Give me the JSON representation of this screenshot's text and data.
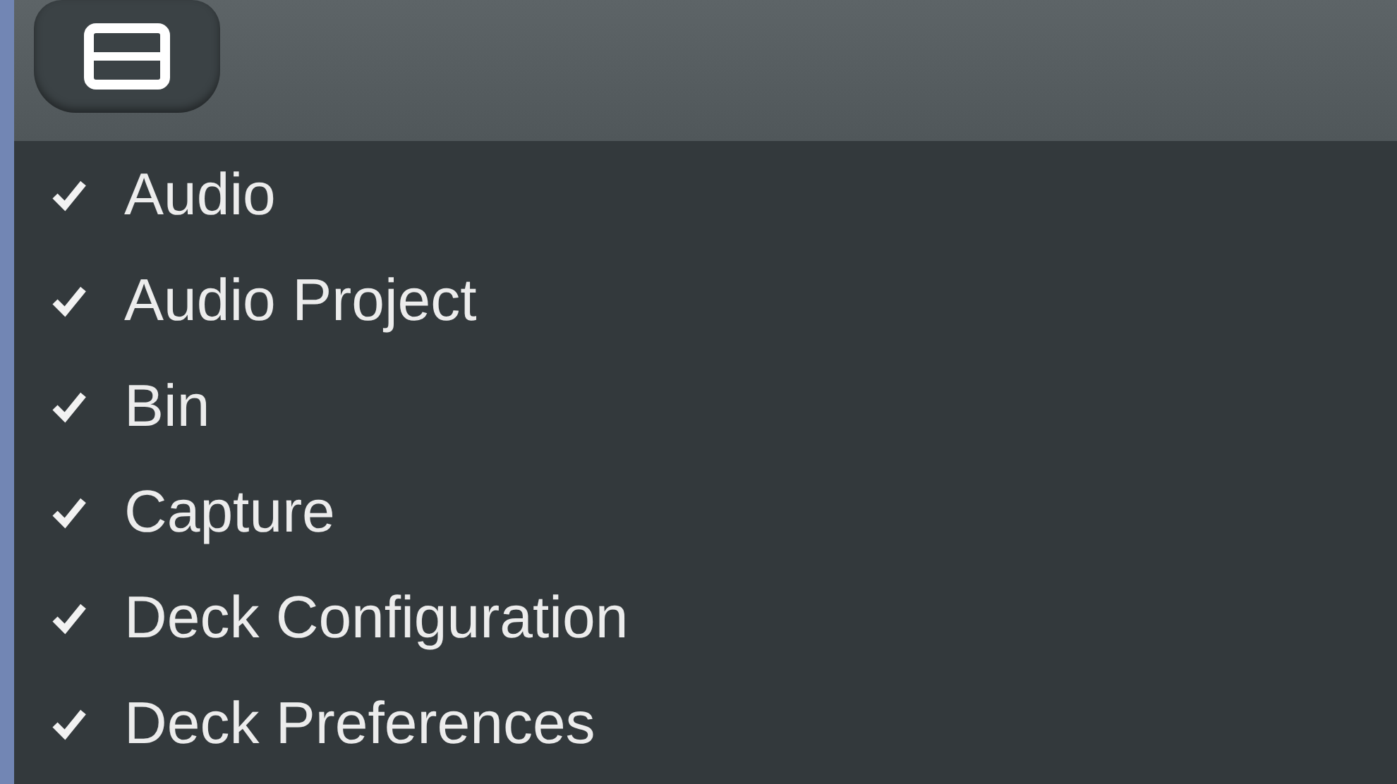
{
  "menu": {
    "items": [
      {
        "label": "Audio",
        "checked": true
      },
      {
        "label": "Audio Project",
        "checked": true
      },
      {
        "label": "Bin",
        "checked": true
      },
      {
        "label": "Capture",
        "checked": true
      },
      {
        "label": "Deck Configuration",
        "checked": true
      },
      {
        "label": "Deck Preferences",
        "checked": true
      }
    ]
  }
}
